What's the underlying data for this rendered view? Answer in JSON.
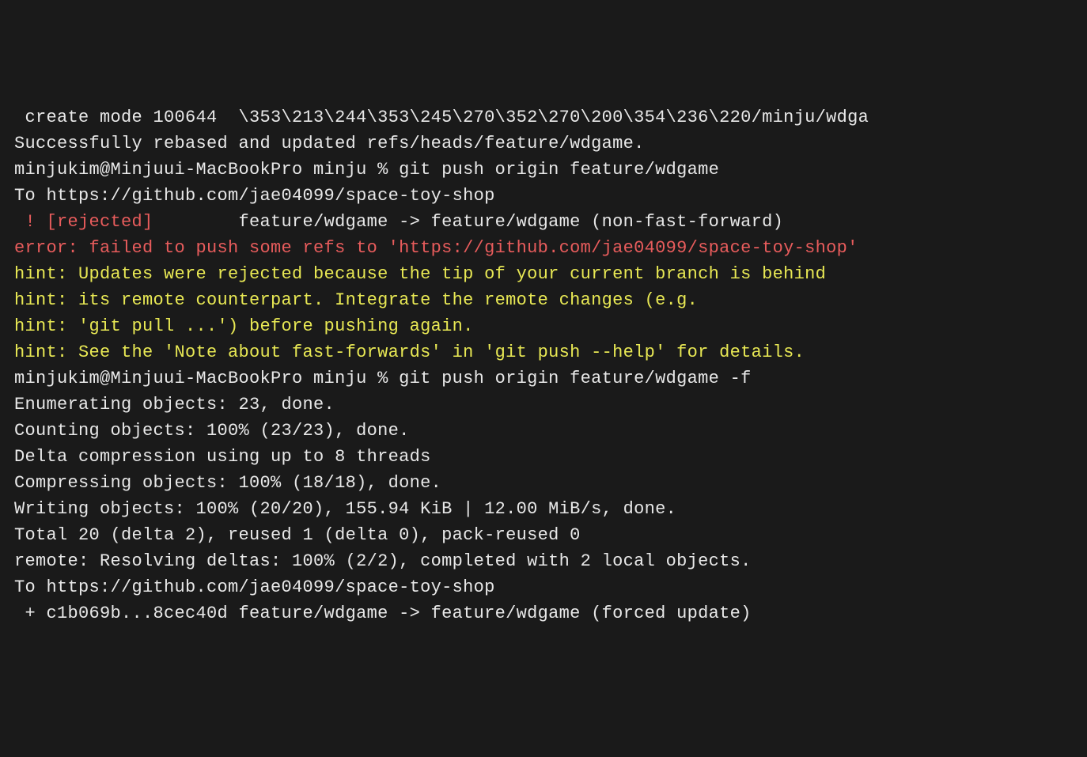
{
  "terminal": {
    "lines": [
      {
        "segments": [
          {
            "color": "white",
            "text": " create mode 100644  \\353\\213\\244\\353\\245\\270\\352\\270\\200\\354\\236\\220/minju/wdga"
          }
        ]
      },
      {
        "segments": [
          {
            "color": "white",
            "text": "Successfully rebased and updated refs/heads/feature/wdgame."
          }
        ]
      },
      {
        "segments": [
          {
            "color": "white",
            "text": "minjukim@Minjuui-MacBookPro minju % git push origin feature/wdgame"
          }
        ]
      },
      {
        "segments": [
          {
            "color": "white",
            "text": "To https://github.com/jae04099/space-toy-shop"
          }
        ]
      },
      {
        "segments": [
          {
            "color": "red",
            "text": " ! [rejected]"
          },
          {
            "color": "white",
            "text": "        feature/wdgame -> feature/wdgame (non-fast-forward)"
          }
        ]
      },
      {
        "segments": [
          {
            "color": "red",
            "text": "error: failed to push some refs to 'https://github.com/jae04099/space-toy-shop'"
          }
        ]
      },
      {
        "segments": [
          {
            "color": "yellow",
            "text": "hint: Updates were rejected because the tip of your current branch is behind"
          }
        ]
      },
      {
        "segments": [
          {
            "color": "yellow",
            "text": "hint: its remote counterpart. Integrate the remote changes (e.g."
          }
        ]
      },
      {
        "segments": [
          {
            "color": "yellow",
            "text": "hint: 'git pull ...') before pushing again."
          }
        ]
      },
      {
        "segments": [
          {
            "color": "yellow",
            "text": "hint: See the 'Note about fast-forwards' in 'git push --help' for details."
          }
        ]
      },
      {
        "segments": [
          {
            "color": "white",
            "text": "minjukim@Minjuui-MacBookPro minju % git push origin feature/wdgame -f"
          }
        ]
      },
      {
        "segments": [
          {
            "color": "white",
            "text": "Enumerating objects: 23, done."
          }
        ]
      },
      {
        "segments": [
          {
            "color": "white",
            "text": "Counting objects: 100% (23/23), done."
          }
        ]
      },
      {
        "segments": [
          {
            "color": "white",
            "text": "Delta compression using up to 8 threads"
          }
        ]
      },
      {
        "segments": [
          {
            "color": "white",
            "text": "Compressing objects: 100% (18/18), done."
          }
        ]
      },
      {
        "segments": [
          {
            "color": "white",
            "text": "Writing objects: 100% (20/20), 155.94 KiB | 12.00 MiB/s, done."
          }
        ]
      },
      {
        "segments": [
          {
            "color": "white",
            "text": "Total 20 (delta 2), reused 1 (delta 0), pack-reused 0"
          }
        ]
      },
      {
        "segments": [
          {
            "color": "white",
            "text": "remote: Resolving deltas: 100% (2/2), completed with 2 local objects."
          }
        ]
      },
      {
        "segments": [
          {
            "color": "white",
            "text": "To https://github.com/jae04099/space-toy-shop"
          }
        ]
      },
      {
        "segments": [
          {
            "color": "white",
            "text": " + c1b069b...8cec40d feature/wdgame -> feature/wdgame (forced update)"
          }
        ]
      }
    ]
  }
}
